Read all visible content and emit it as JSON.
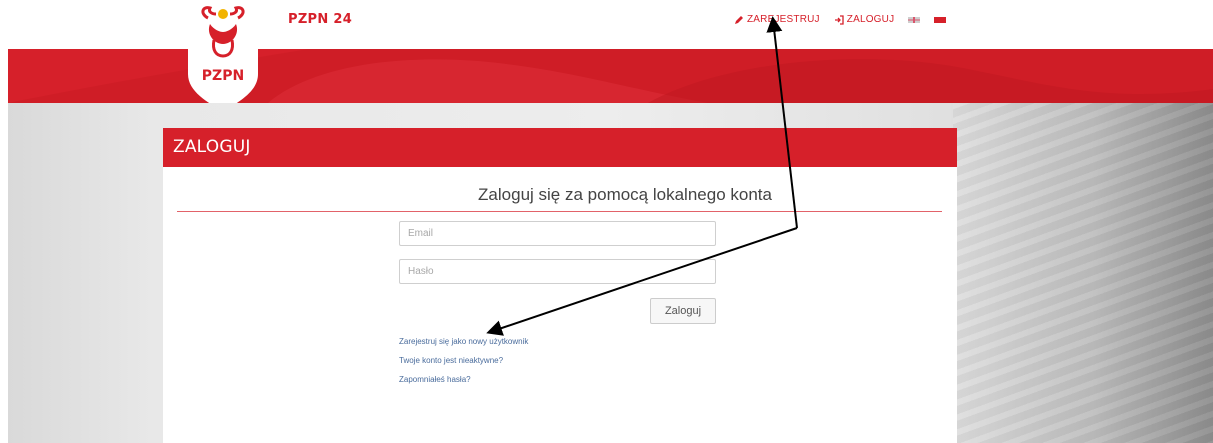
{
  "header": {
    "brand_name": "PZPN 24",
    "logo_text": "PZPN",
    "nav": {
      "register_label": "ZAREJESTRUJ",
      "login_label": "ZALOGUJ"
    },
    "languages": [
      "en-flag-icon",
      "pl-flag-icon"
    ]
  },
  "panel": {
    "title": "ZALOGUJ",
    "heading": "Zaloguj się za pomocą lokalnego konta",
    "email_placeholder": "Email",
    "password_placeholder": "Hasło",
    "login_button": "Zaloguj",
    "links": {
      "register": "Zarejestruj się jako nowy użytkownik",
      "inactive": "Twoje konto jest nieaktywne?",
      "forgot": "Zapomniałeś hasła?"
    }
  },
  "colors": {
    "brand_red": "#d6202a",
    "link_blue": "#4a6c9c"
  }
}
